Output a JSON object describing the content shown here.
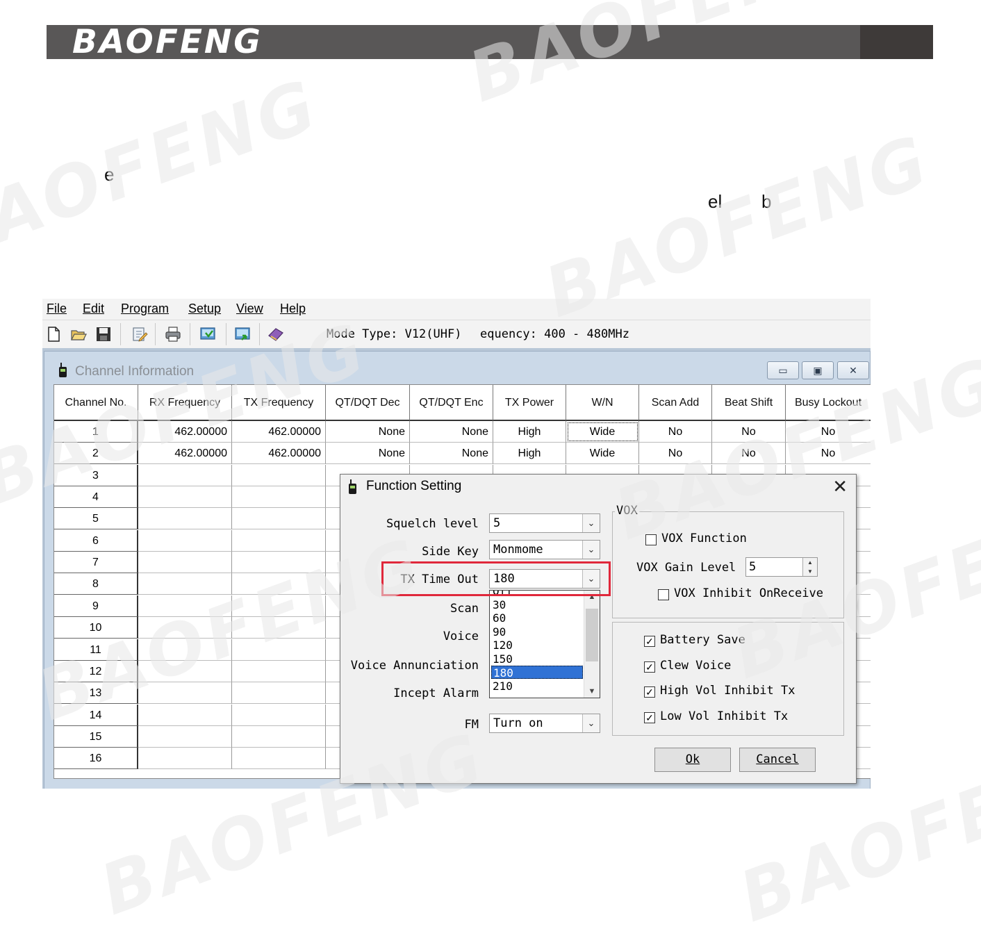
{
  "header": {
    "brand": "BAOFENG"
  },
  "page_fragments": {
    "frag1": "e",
    "frag2": "el",
    "frag3": "b"
  },
  "watermark": {
    "text": "BAOFENG"
  },
  "menu": {
    "items": [
      "File",
      "Edit",
      "Program",
      "Setup",
      "View",
      "Help"
    ]
  },
  "toolbar": {
    "icons": [
      "new-icon",
      "open-icon",
      "save-icon",
      "edit-icon",
      "print-icon",
      "read-radio-icon",
      "write-radio-icon",
      "book-icon"
    ],
    "mode_type": "Mode Type: V12(UHF)",
    "frequency": "equency: 400 - 480MHz"
  },
  "channel_window": {
    "title": "Channel Information",
    "buttons": [
      "minimize",
      "maximize",
      "close"
    ],
    "columns": [
      "Channel No.",
      "RX Frequency",
      "TX Frequency",
      "QT/DQT Dec",
      "QT/DQT Enc",
      "TX Power",
      "W/N",
      "Scan Add",
      "Beat Shift",
      "Busy Lockout"
    ],
    "rows": [
      [
        "1",
        "462.00000",
        "462.00000",
        "None",
        "None",
        "High",
        "Wide",
        "No",
        "No",
        "No"
      ],
      [
        "2",
        "462.00000",
        "462.00000",
        "None",
        "None",
        "High",
        "Wide",
        "No",
        "No",
        "No"
      ],
      [
        "3"
      ],
      [
        "4"
      ],
      [
        "5"
      ],
      [
        "6"
      ],
      [
        "7"
      ],
      [
        "8"
      ],
      [
        "9"
      ],
      [
        "10"
      ],
      [
        "11"
      ],
      [
        "12"
      ],
      [
        "13"
      ],
      [
        "14"
      ],
      [
        "15"
      ],
      [
        "16"
      ]
    ]
  },
  "function_dialog": {
    "title": "Function Setting",
    "close_glyph": "✕",
    "squelch_label": "Squelch level",
    "squelch_value": "5",
    "side_key_label": "Side Key",
    "side_key_value": "Monmome",
    "tx_timeout_label": "TX Time Out",
    "tx_timeout_value": "180",
    "tx_timeout_options": [
      "Off",
      "30",
      "60",
      "90",
      "120",
      "150",
      "180",
      "210"
    ],
    "tx_timeout_selected": "180",
    "scan_label": "Scan",
    "voice_label": "Voice",
    "voice_annunciation_label": "Voice Annunciation",
    "incept_alarm_label": "Incept Alarm",
    "fm_label": "FM",
    "fm_value": "Turn on",
    "vox_group": "VOX",
    "vox_function_label": "VOX Function",
    "vox_function_checked": false,
    "vox_gain_label": "VOX Gain Level",
    "vox_gain_value": "5",
    "vox_inhibit_label": "VOX Inhibit OnReceive",
    "vox_inhibit_checked": false,
    "battery_save_label": "Battery Save",
    "battery_save_checked": true,
    "clew_voice_label": "Clew Voice",
    "clew_voice_checked": true,
    "high_vol_label": "High Vol Inhibit Tx",
    "high_vol_checked": true,
    "low_vol_label": "Low Vol Inhibit Tx",
    "low_vol_checked": true,
    "ok_label": "Ok",
    "cancel_label": "Cancel",
    "highlight_color": "#e0283b",
    "selection_color": "#3072d5"
  }
}
